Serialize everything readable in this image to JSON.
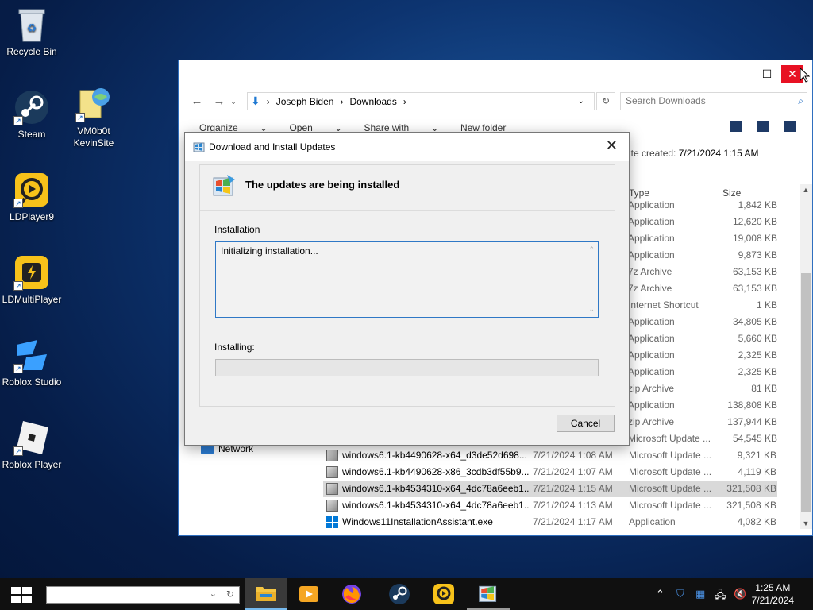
{
  "desktop": {
    "icons": [
      {
        "label": "Recycle Bin"
      },
      {
        "label": "Steam"
      },
      {
        "label": "VM0b0t KevinSite"
      },
      {
        "label": "LDPlayer9"
      },
      {
        "label": "LDMultiPlayer"
      },
      {
        "label": "Roblox Studio"
      },
      {
        "label": "Roblox Player"
      }
    ]
  },
  "explorer": {
    "breadcrumb": [
      "Joseph Biden",
      "Downloads"
    ],
    "search_placeholder": "Search Downloads",
    "commands": [
      "Organize",
      "Open",
      "Share with",
      "New folder"
    ],
    "date_created_label": "ate created:",
    "date_created_value": "7/21/2024 1:15 AM",
    "columns": {
      "type": "Type",
      "size": "Size"
    },
    "partial_rows": [
      {
        "type": "Application",
        "size": "1,842 KB"
      },
      {
        "type": "Application",
        "size": "12,620 KB"
      },
      {
        "type": "Application",
        "size": "19,008 KB"
      },
      {
        "type": "Application",
        "size": "9,873 KB"
      },
      {
        "type": "7z Archive",
        "size": "63,153 KB"
      },
      {
        "type": "7z Archive",
        "size": "63,153 KB"
      },
      {
        "type": "Internet Shortcut",
        "size": "1 KB"
      },
      {
        "type": "Application",
        "size": "34,805 KB"
      },
      {
        "type": "Application",
        "size": "5,660 KB"
      },
      {
        "type": "Application",
        "size": "2,325 KB"
      },
      {
        "type": "Application",
        "size": "2,325 KB"
      },
      {
        "type": "zip Archive",
        "size": "81 KB"
      },
      {
        "type": "Application",
        "size": "138,808 KB"
      },
      {
        "type": "zip Archive",
        "size": "137,944 KB"
      },
      {
        "type": "Microsoft Update ...",
        "size": "54,545 KB"
      }
    ],
    "files": [
      {
        "name": "windows6.1-kb4490628-x64_d3de52d698...",
        "date": "7/21/2024 1:08 AM",
        "type": "Microsoft Update ...",
        "size": "9,321 KB"
      },
      {
        "name": "windows6.1-kb4490628-x86_3cdb3df55b9...",
        "date": "7/21/2024 1:07 AM",
        "type": "Microsoft Update ...",
        "size": "4,119 KB"
      },
      {
        "name": "windows6.1-kb4534310-x64_4dc78a6eeb1...",
        "date": "7/21/2024 1:15 AM",
        "type": "Microsoft Update ...",
        "size": "321,508 KB"
      },
      {
        "name": "windows6.1-kb4534310-x64_4dc78a6eeb1...",
        "date": "7/21/2024 1:13 AM",
        "type": "Microsoft Update ...",
        "size": "321,508 KB"
      },
      {
        "name": "Windows11InstallationAssistant.exe",
        "date": "7/21/2024 1:17 AM",
        "type": "Application",
        "size": "4,082 KB"
      }
    ],
    "nav_network": "Network"
  },
  "dialog": {
    "title": "Download and Install Updates",
    "heading": "The updates are being installed",
    "installation_label": "Installation",
    "log_text": "Initializing installation...",
    "installing_label": "Installing:",
    "progress": 0,
    "cancel_label": "Cancel"
  },
  "taskbar": {
    "time": "1:25 AM",
    "date": "7/21/2024"
  },
  "colors": {
    "accent": "#0078d7",
    "close_red": "#e81123",
    "taskbar": "#101010"
  }
}
